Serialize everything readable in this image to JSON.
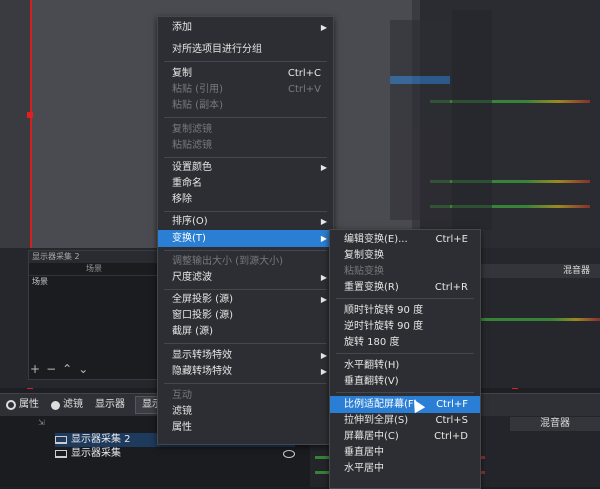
{
  "context_menu": {
    "items": [
      {
        "label": "添加",
        "shortcut": "",
        "submenu": true,
        "disabled": false
      },
      {
        "label": "对所选项目进行分组",
        "shortcut": "",
        "submenu": false,
        "disabled": false
      },
      {
        "label": "复制",
        "shortcut": "Ctrl+C",
        "submenu": false,
        "disabled": false
      },
      {
        "label": "粘贴 (引用)",
        "shortcut": "Ctrl+V",
        "submenu": false,
        "disabled": true
      },
      {
        "label": "粘贴 (副本)",
        "shortcut": "",
        "submenu": false,
        "disabled": true
      },
      {
        "label": "复制滤镜",
        "shortcut": "",
        "submenu": false,
        "disabled": true
      },
      {
        "label": "粘贴滤镜",
        "shortcut": "",
        "submenu": false,
        "disabled": true
      },
      {
        "label": "设置颜色",
        "shortcut": "",
        "submenu": true,
        "disabled": false
      },
      {
        "label": "重命名",
        "shortcut": "",
        "submenu": false,
        "disabled": false
      },
      {
        "label": "移除",
        "shortcut": "",
        "submenu": false,
        "disabled": false
      },
      {
        "label": "排序(O)",
        "shortcut": "",
        "submenu": true,
        "disabled": false
      },
      {
        "label": "变换(T)",
        "shortcut": "",
        "submenu": true,
        "disabled": false,
        "highlighted": true
      },
      {
        "label": "调整输出大小 (到源大小)",
        "shortcut": "",
        "submenu": false,
        "disabled": true
      },
      {
        "label": "尺度滤波",
        "shortcut": "",
        "submenu": true,
        "disabled": false
      },
      {
        "label": "全屏投影 (源)",
        "shortcut": "",
        "submenu": true,
        "disabled": false
      },
      {
        "label": "窗口投影 (源)",
        "shortcut": "",
        "submenu": false,
        "disabled": false
      },
      {
        "label": "截屏 (源)",
        "shortcut": "",
        "submenu": false,
        "disabled": false
      },
      {
        "label": "显示转场特效",
        "shortcut": "",
        "submenu": true,
        "disabled": false
      },
      {
        "label": "隐藏转场特效",
        "shortcut": "",
        "submenu": true,
        "disabled": false
      },
      {
        "label": "互动",
        "shortcut": "",
        "submenu": false,
        "disabled": true
      },
      {
        "label": "滤镜",
        "shortcut": "",
        "submenu": false,
        "disabled": false
      },
      {
        "label": "属性",
        "shortcut": "",
        "submenu": false,
        "disabled": false
      }
    ]
  },
  "transform_menu": {
    "items": [
      {
        "label": "编辑变换(E)...",
        "shortcut": "Ctrl+E",
        "disabled": false
      },
      {
        "label": "复制变换",
        "shortcut": "",
        "disabled": false
      },
      {
        "label": "粘贴变换",
        "shortcut": "",
        "disabled": true
      },
      {
        "label": "重置变换(R)",
        "shortcut": "Ctrl+R",
        "disabled": false
      },
      {
        "label": "顺时针旋转 90 度",
        "shortcut": "",
        "disabled": false
      },
      {
        "label": "逆时针旋转 90 度",
        "shortcut": "",
        "disabled": false
      },
      {
        "label": "旋转 180 度",
        "shortcut": "",
        "disabled": false
      },
      {
        "label": "水平翻转(H)",
        "shortcut": "",
        "disabled": false
      },
      {
        "label": "垂直翻转(V)",
        "shortcut": "",
        "disabled": false
      },
      {
        "label": "比例适配屏幕(F)",
        "shortcut": "Ctrl+F",
        "disabled": false,
        "highlighted": true
      },
      {
        "label": "拉伸到全屏(S)",
        "shortcut": "Ctrl+S",
        "disabled": false
      },
      {
        "label": "屏幕居中(C)",
        "shortcut": "Ctrl+D",
        "disabled": false
      },
      {
        "label": "垂直居中",
        "shortcut": "",
        "disabled": false
      },
      {
        "label": "水平居中",
        "shortcut": "",
        "disabled": false
      }
    ]
  },
  "scene_panel": {
    "title": "显示器采集 2",
    "header": "场景",
    "row": "场景"
  },
  "toolbar": {
    "properties": "属性",
    "filters": "滤镜",
    "display_label": "显示器",
    "display_dropdown": "显示器"
  },
  "sources": {
    "items": [
      {
        "label": "显示器采集 2"
      },
      {
        "label": "显示器采集"
      }
    ]
  },
  "mixer": {
    "title": "混音器"
  },
  "colors": {
    "menu_bg": "#2d2e33",
    "highlight": "#2a7fd4",
    "selection_border": "#e02020"
  }
}
